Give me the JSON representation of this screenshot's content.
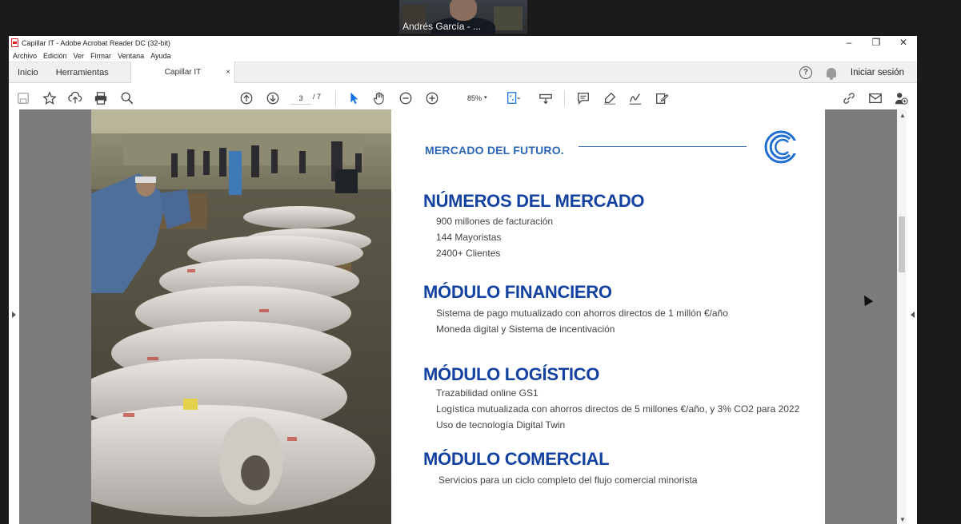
{
  "participant": {
    "name": "Andrés García - ..."
  },
  "window": {
    "title": "Capillar IT - Adobe Acrobat Reader DC (32-bit)",
    "controls": {
      "minimize": "–",
      "restore": "❐",
      "close": "✕"
    }
  },
  "menu": [
    "Archivo",
    "Edición",
    "Ver",
    "Firmar",
    "Ventana",
    "Ayuda"
  ],
  "tabs": {
    "home": "Inicio",
    "tools": "Herramientas",
    "document": "Capillar IT",
    "close": "×",
    "help": "?",
    "signin": "Iniciar sesión"
  },
  "toolbar": {
    "page_current": "3",
    "page_total": "/ 7",
    "zoom": "85%",
    "zoom_arrow": "▾"
  },
  "icons": [
    "save-icon",
    "star-icon",
    "upload-icon",
    "print-icon",
    "search-icon",
    "prev-page-icon",
    "next-page-icon",
    "select-icon",
    "hand-icon",
    "zoom-out-icon",
    "zoom-in-icon",
    "fit-page-icon",
    "scroll-mode-icon",
    "comment-icon",
    "highlight-icon",
    "sign-icon",
    "edit-icon",
    "share-link-icon",
    "email-icon",
    "add-user-icon",
    "bell-icon",
    "help-icon"
  ],
  "document": {
    "headline": "MERCADO DEL FUTURO.",
    "sections": [
      {
        "title": "NÚMEROS DEL MERCADO",
        "lines": [
          "900 millones de facturación",
          "144 Mayoristas",
          "2400+ Clientes"
        ]
      },
      {
        "title": "MÓDULO FINANCIERO",
        "lines": [
          "Sistema de pago mutualizado con ahorros directos de 1 millón €/año",
          "Moneda digital y Sistema de incentivación"
        ]
      },
      {
        "title": "MÓDULO LOGÍSTICO",
        "lines": [
          "Trazabilidad online GS1",
          "Logística mutualizada con ahorros directos de 5 millones €/año, y 3% CO2 para 2022",
          "Uso de tecnología Digital Twin"
        ]
      },
      {
        "title": "MÓDULO COMERCIAL",
        "lines": [
          "Servicios para un ciclo completo del flujo comercial minorista"
        ]
      }
    ]
  },
  "colors": {
    "accent": "#1342a0",
    "headline": "#2a67b6",
    "canvas": "#7c7c7c"
  }
}
